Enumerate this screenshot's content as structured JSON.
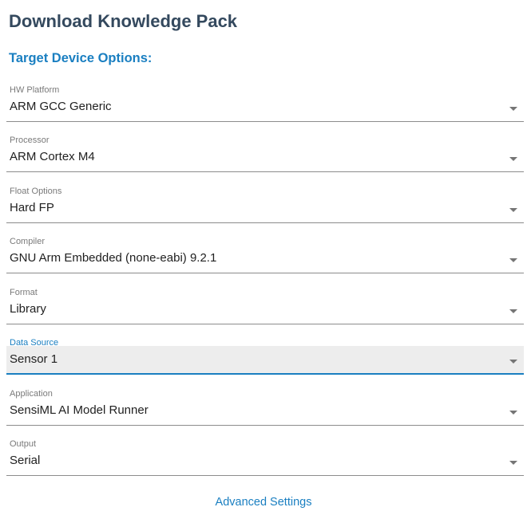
{
  "page": {
    "title": "Download Knowledge Pack",
    "subtitle": "Target Device Options:"
  },
  "fields": [
    {
      "label": "HW Platform",
      "value": "ARM GCC Generic"
    },
    {
      "label": "Processor",
      "value": "ARM Cortex M4"
    },
    {
      "label": "Float Options",
      "value": "Hard FP"
    },
    {
      "label": "Compiler",
      "value": "GNU Arm Embedded (none-eabi) 9.2.1"
    },
    {
      "label": "Format",
      "value": "Library"
    },
    {
      "label": "Data Source",
      "value": "Sensor 1",
      "focused": true
    },
    {
      "label": "Application",
      "value": "SensiML AI Model Runner"
    },
    {
      "label": "Output",
      "value": "Serial"
    }
  ],
  "advanced_settings": {
    "label": "Advanced Settings"
  },
  "colors": {
    "title": "#34495e",
    "accent": "#1a7fc1",
    "focused_bg": "#ededed"
  }
}
